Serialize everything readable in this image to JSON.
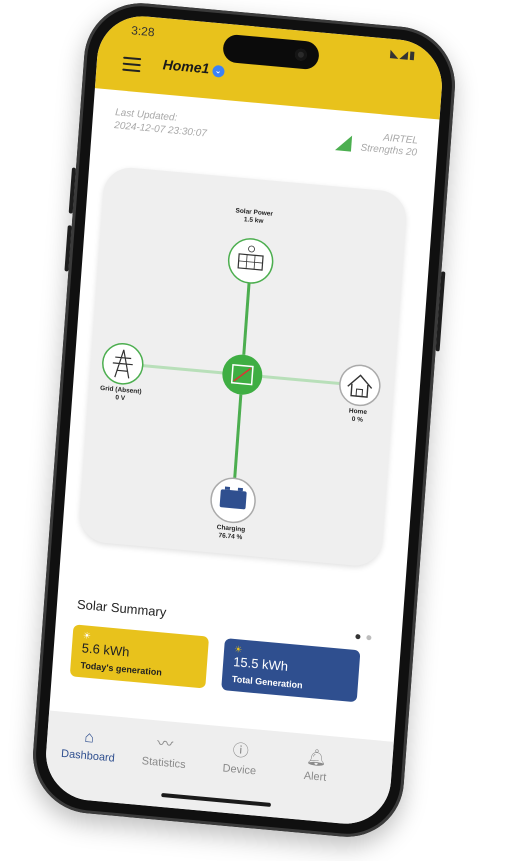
{
  "status_bar": {
    "time": "3:28",
    "icons": "◣◢▮"
  },
  "app_bar": {
    "menu_icon": "hamburger-menu-icon",
    "title": "Home1",
    "dropdown_icon": "chevron-down-icon"
  },
  "updated": {
    "label": "Last Updated:",
    "datetime": "2024-12-07 23:30:07"
  },
  "network": {
    "operator": "AIRTEL",
    "strength": "Strengths 20",
    "icon": "signal-icon"
  },
  "flow": {
    "solar": {
      "title": "Solar Power",
      "value": "1.5 kw",
      "icon": "solar-panel-icon"
    },
    "grid": {
      "title": "Grid (Absent)",
      "value": "0 V",
      "icon": "transmission-tower-icon"
    },
    "home": {
      "title": "Home",
      "value": "0 %",
      "icon": "house-icon"
    },
    "battery": {
      "title": "Charging",
      "value": "76.74 %",
      "icon": "battery-icon"
    },
    "inverter": {
      "icon": "inverter-icon"
    },
    "colors": {
      "active": "#4cae4f",
      "inactive": "#b8dfb9",
      "hub": "#3fae43"
    }
  },
  "summary": {
    "title": "Solar Summary",
    "pages": 2,
    "active_page": 1,
    "cards": [
      {
        "value": "5.6 kWh",
        "label": "Today's generation",
        "color": "#e8c21c",
        "icon": "sun-icon"
      },
      {
        "value": "15.5 kWh",
        "label": "Total Generation",
        "color": "#2f4f8f",
        "icon": "sun-icon"
      }
    ]
  },
  "nav": {
    "items": [
      {
        "label": "Dashboard",
        "icon": "home-icon",
        "active": true
      },
      {
        "label": "Statistics",
        "icon": "chart-line-icon",
        "active": false
      },
      {
        "label": "Device",
        "icon": "info-icon",
        "active": false
      },
      {
        "label": "Alert",
        "icon": "bell-icon",
        "active": false
      }
    ]
  }
}
